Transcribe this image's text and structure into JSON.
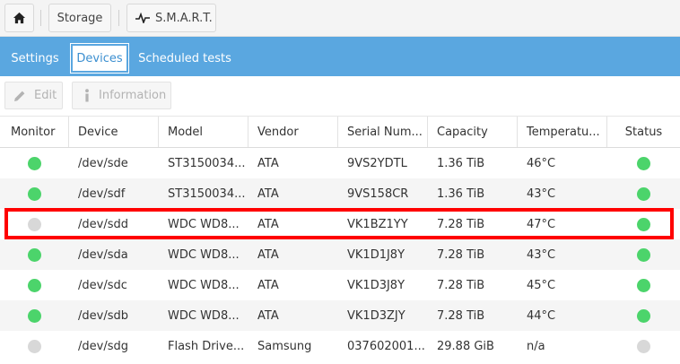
{
  "breadcrumb": {
    "storage": "Storage",
    "smart": "S.M.A.R.T."
  },
  "tabs": [
    {
      "label": "Settings"
    },
    {
      "label": "Devices"
    },
    {
      "label": "Scheduled tests"
    }
  ],
  "active_tab": "Devices",
  "toolbar": {
    "edit": "Edit",
    "information": "Information"
  },
  "columns": [
    "Monitor",
    "Device",
    "Model",
    "Vendor",
    "Serial Num...",
    "Capacity",
    "Temperatu...",
    "Status"
  ],
  "rows": [
    {
      "monitor": "green",
      "device": "/dev/sde",
      "model": "ST3150034...",
      "vendor": "ATA",
      "serial": "9VS2YDTL",
      "capacity": "1.36 TiB",
      "temperature": "46°C",
      "status": "green"
    },
    {
      "monitor": "green",
      "device": "/dev/sdf",
      "model": "ST3150034...",
      "vendor": "ATA",
      "serial": "9VS158CR",
      "capacity": "1.36 TiB",
      "temperature": "43°C",
      "status": "green"
    },
    {
      "monitor": "grey",
      "device": "/dev/sdd",
      "model": "WDC WD8...",
      "vendor": "ATA",
      "serial": "VK1BZ1YY",
      "capacity": "7.28 TiB",
      "temperature": "47°C",
      "status": "green"
    },
    {
      "monitor": "green",
      "device": "/dev/sda",
      "model": "WDC WD8...",
      "vendor": "ATA",
      "serial": "VK1D1J8Y",
      "capacity": "7.28 TiB",
      "temperature": "43°C",
      "status": "green"
    },
    {
      "monitor": "green",
      "device": "/dev/sdc",
      "model": "WDC WD8...",
      "vendor": "ATA",
      "serial": "VK1D3J8Y",
      "capacity": "7.28 TiB",
      "temperature": "45°C",
      "status": "green"
    },
    {
      "monitor": "green",
      "device": "/dev/sdb",
      "model": "WDC WD8...",
      "vendor": "ATA",
      "serial": "VK1D3ZJY",
      "capacity": "7.28 TiB",
      "temperature": "44°C",
      "status": "green"
    },
    {
      "monitor": "grey",
      "device": "/dev/sdg",
      "model": "Flash Drive...",
      "vendor": "Samsung",
      "serial": "037602001...",
      "capacity": "29.88 GiB",
      "temperature": "n/a",
      "status": "grey"
    }
  ],
  "colors": {
    "accent": "#5aa7e0",
    "ok": "#4cd46b",
    "off": "#d8d8d8",
    "highlight": "#ff0000"
  },
  "icons": {
    "home": "home-icon",
    "smart": "heartbeat-icon",
    "edit": "pencil-icon",
    "info": "info-icon"
  }
}
